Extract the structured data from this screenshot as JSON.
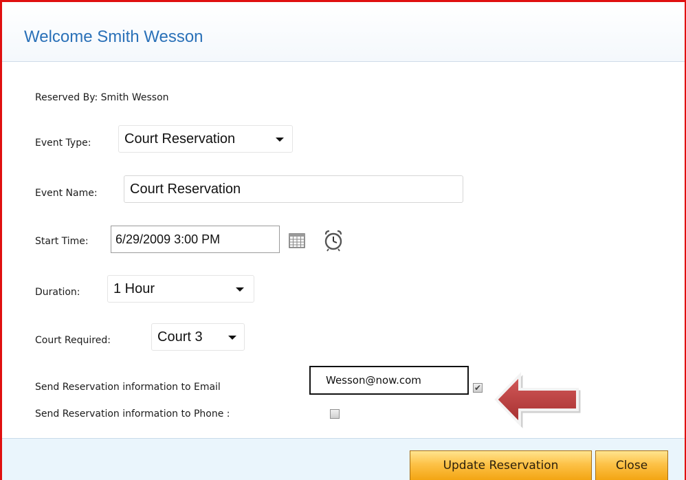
{
  "header": {
    "title": "Welcome Smith Wesson"
  },
  "form": {
    "reserved_by": "Reserved By: Smith Wesson",
    "event_type_label": "Event Type:",
    "event_type_value": "Court Reservation",
    "event_name_label": "Event Name:",
    "event_name_value": "Court Reservation",
    "start_time_label": "Start Time:",
    "start_time_value": "6/29/2009 3:00 PM",
    "duration_label": "Duration:",
    "duration_value": "1 Hour",
    "court_label": "Court Required:",
    "court_value": "Court 3",
    "email_label": "Send Reservation information to Email",
    "email_value": "Wesson@now.com",
    "email_checked": true,
    "phone_label": "Send Reservation information to Phone :",
    "phone_checked": false
  },
  "buttons": {
    "update_label": "Update Reservation",
    "close_label": "Close"
  },
  "icons": {
    "calendar": "calendar-icon",
    "clock": "alarm-clock-icon",
    "arrow": "left-arrow-annotation"
  },
  "colors": {
    "frame_border": "#e01010",
    "title_text": "#2a71b8",
    "button_orange": "#fdc247",
    "arrow_red": "#b23a3a",
    "footer_bg": "#eaf5fc"
  }
}
